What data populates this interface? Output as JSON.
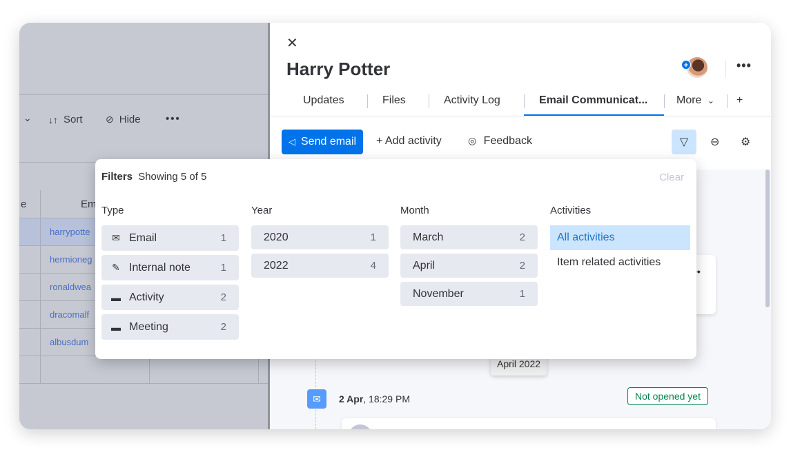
{
  "board": {
    "toolbar": {
      "chevron": "⌄",
      "sort_label": "Sort",
      "hide_label": "Hide",
      "more": "•••"
    },
    "columns": [
      "e",
      "Em"
    ],
    "emails": [
      "harrypotte",
      "hermioneg",
      "ronaldwea",
      "dracomalf",
      "albusdum"
    ]
  },
  "panel": {
    "close": "✕",
    "title": "Harry Potter",
    "avatar_plus": "+",
    "more": "•••",
    "tabs": [
      "Updates",
      "Files",
      "Activity Log",
      "Email Communicat...",
      "More",
      "+"
    ],
    "more_chevron": "⌄",
    "actions": {
      "send_email": "Send email",
      "add_activity": "+  Add activity",
      "feedback": "Feedback"
    },
    "timeline": {
      "month_pill": "April 2022",
      "email_day": "2 Apr",
      "email_time": ", 18:29 PM",
      "status": "Not opened yet",
      "card_dots": "••"
    }
  },
  "filters": {
    "title": "Filters",
    "showing": "Showing 5 of 5",
    "clear": "Clear",
    "type": {
      "label": "Type",
      "items": [
        {
          "icon": "envelope-icon",
          "label": "Email",
          "count": "1"
        },
        {
          "icon": "note-icon",
          "label": "Internal note",
          "count": "1"
        },
        {
          "icon": "calendar-icon",
          "label": "Activity",
          "count": "2"
        },
        {
          "icon": "calendar-icon",
          "label": "Meeting",
          "count": "2"
        }
      ]
    },
    "year": {
      "label": "Year",
      "items": [
        {
          "label": "2020",
          "count": "1"
        },
        {
          "label": "2022",
          "count": "4"
        }
      ]
    },
    "month": {
      "label": "Month",
      "items": [
        {
          "label": "March",
          "count": "2"
        },
        {
          "label": "April",
          "count": "2"
        },
        {
          "label": "November",
          "count": "1"
        }
      ]
    },
    "activities": {
      "label": "Activities",
      "items": [
        {
          "label": "All activities",
          "selected": true
        },
        {
          "label": "Item related activities",
          "selected": false
        }
      ]
    }
  },
  "colors": {
    "primary": "#0073ea",
    "selected_bg": "#cce5ff",
    "status_green": "#00854d",
    "chip_bg": "#e6e9ef"
  }
}
